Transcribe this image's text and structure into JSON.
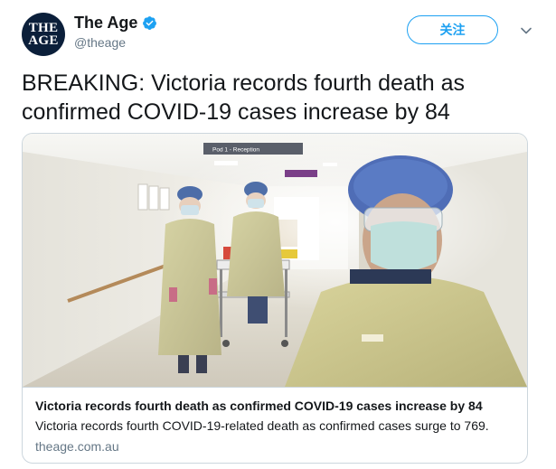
{
  "account": {
    "display_name": "The Age",
    "handle": "@theage",
    "avatar_line1": "THE",
    "avatar_line2": "AGE",
    "verified_icon": "verified-badge-icon"
  },
  "follow_button": {
    "label": "关注"
  },
  "menu": {
    "icon": "chevron-down-icon"
  },
  "tweet": {
    "text": "BREAKING: Victoria records fourth death as confirmed COVID-19 cases increase by 84"
  },
  "card": {
    "image_sign": "Pod 1 - Reception",
    "title": "Victoria records fourth death as confirmed COVID-19 cases increase by 84",
    "description": "Victoria records fourth COVID-19-related death as confirmed cases surge to 769.",
    "domain": "theage.com.au"
  },
  "colors": {
    "accent": "#1da1f2",
    "text": "#14171a",
    "secondary_text": "#657786",
    "border": "#ccd6dd",
    "avatar_bg": "#0b1f3a"
  }
}
